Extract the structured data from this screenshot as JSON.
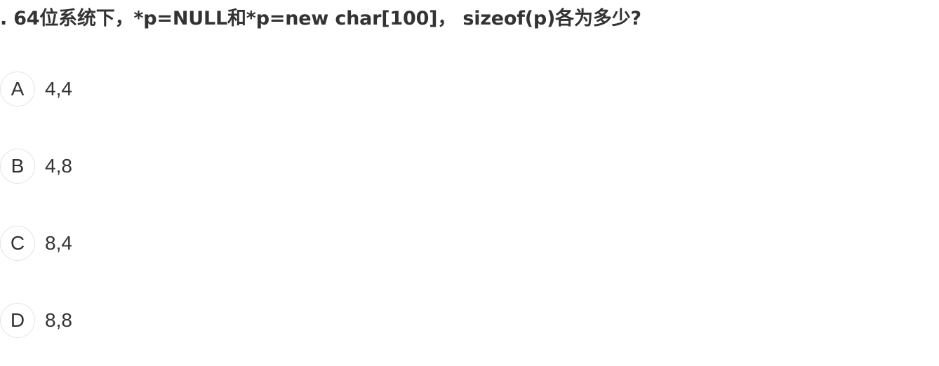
{
  "question": {
    "number": ".",
    "text": "64位系统下，*p=NULL和*p=new char[100]， sizeof(p)各为多少?"
  },
  "options": [
    {
      "letter": "A",
      "text": "4,4"
    },
    {
      "letter": "B",
      "text": "4,8"
    },
    {
      "letter": "C",
      "text": "8,4"
    },
    {
      "letter": "D",
      "text": "8,8"
    }
  ]
}
